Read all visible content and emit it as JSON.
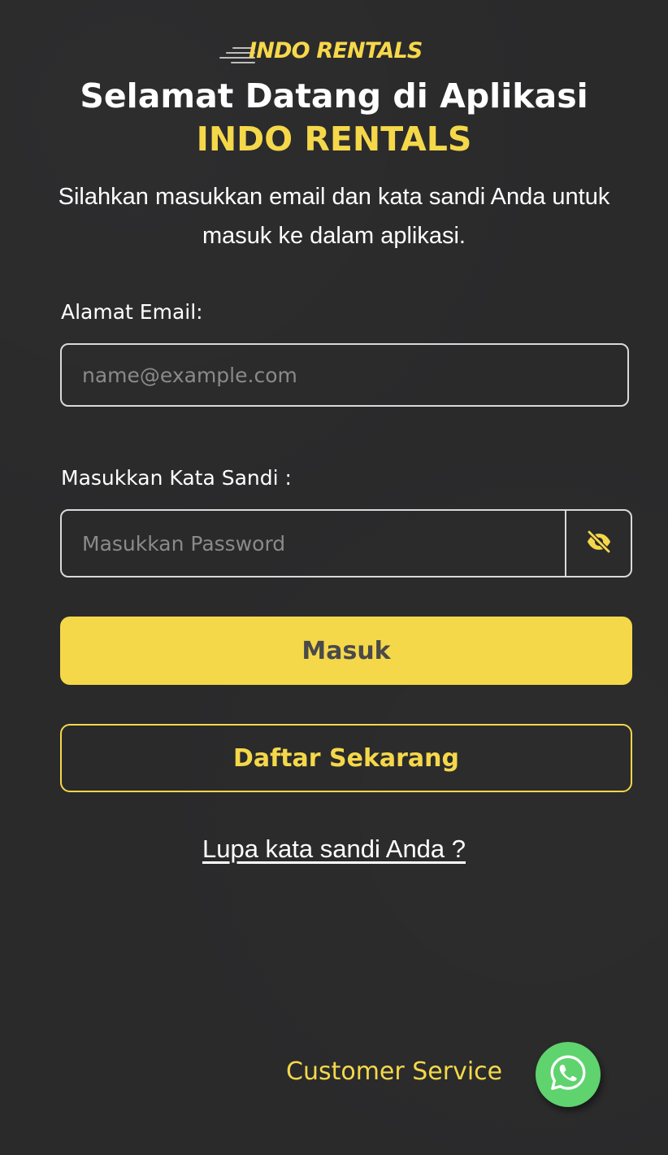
{
  "brand": {
    "logo_text": "INDO RENTALS",
    "accent_color": "#f5d84a",
    "background_color": "#2a2a2b"
  },
  "header": {
    "title_line1": "Selamat Datang di Aplikasi",
    "title_line2": "INDO RENTALS",
    "subtitle": "Silahkan masukkan email dan kata sandi Anda untuk masuk ke dalam aplikasi."
  },
  "form": {
    "email": {
      "label": "Alamat Email:",
      "placeholder": "name@example.com",
      "value": ""
    },
    "password": {
      "label": "Masukkan Kata Sandi :",
      "placeholder": "Masukkan Password",
      "value": "",
      "toggle_icon": "eye-slash-icon"
    },
    "submit_label": "Masuk",
    "register_label": "Daftar Sekarang",
    "forgot_label": "Lupa kata sandi Anda ?"
  },
  "support": {
    "label": "Customer Service",
    "icon": "whatsapp-icon"
  }
}
